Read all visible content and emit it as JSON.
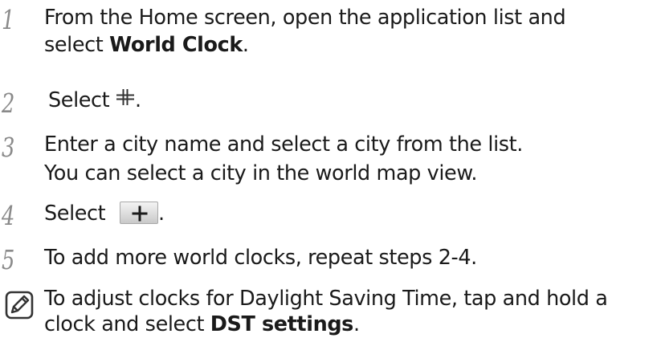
{
  "steps": [
    {
      "number": "1",
      "line1": "From the Home screen, open the application list and",
      "line2_prefix": "select ",
      "line2_bold": "World Clock",
      "line2_suffix": "."
    },
    {
      "number": "2",
      "prefix": "Select ",
      "icon": "add-crosshair-icon",
      "suffix": "."
    },
    {
      "number": "3",
      "line1": "Enter a city name and select a city from the list.",
      "line2": "You can select a city in the world map view."
    },
    {
      "number": "4",
      "prefix": "Select ",
      "button_icon": "plus-button-icon",
      "suffix": "."
    },
    {
      "number": "5",
      "text": "To add more world clocks, repeat steps 2-4."
    }
  ],
  "note": {
    "icon": "note-pencil-icon",
    "line1": "To adjust clocks for Daylight Saving Time, tap and hold a",
    "line2_prefix": "clock and select ",
    "line2_bold": "DST settings",
    "line2_suffix": "."
  },
  "colors": {
    "text": "#1a1a1a",
    "step_number": "#8a8a8a",
    "icon_stroke": "#333333"
  }
}
